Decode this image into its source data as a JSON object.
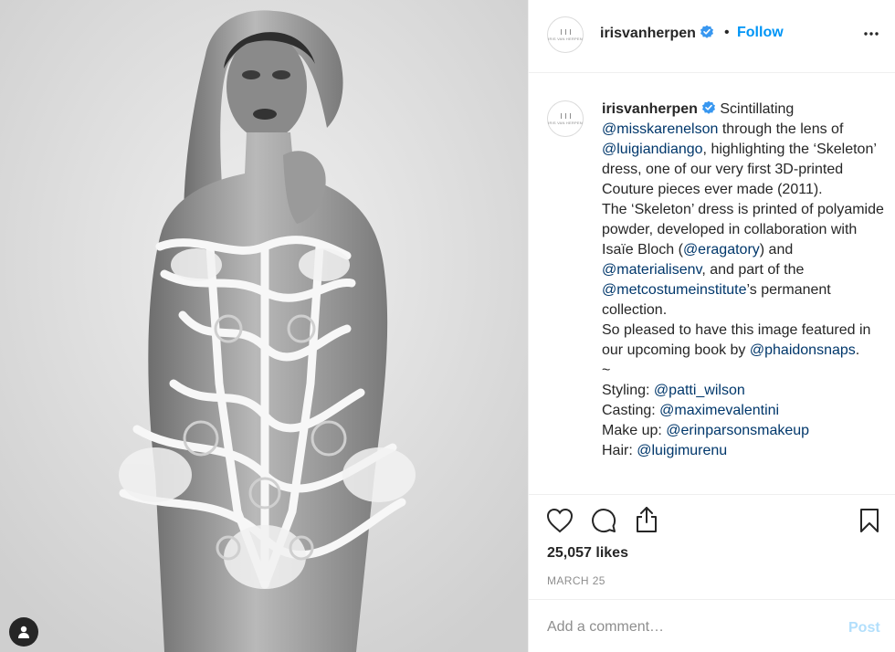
{
  "post": {
    "username": "irisvanherpen",
    "avatar_logo_text": "IRIS VAN HERPEN",
    "separator": "•",
    "follow_label": "Follow"
  },
  "caption": {
    "username": "irisvanherpen",
    "segments": [
      {
        "text": " Scintillating ",
        "mention": false
      },
      {
        "text": "@misskarenelson",
        "mention": true
      },
      {
        "text": " through the lens of ",
        "mention": false
      },
      {
        "text": "@luigiandiango",
        "mention": true
      },
      {
        "text": ", highlighting the ‘Skeleton’ dress, one of our very first 3D-printed Couture pieces ever made (2011).\nThe ‘Skeleton’ dress is printed of polyamide powder, developed in collaboration with Isaïe Bloch (",
        "mention": false
      },
      {
        "text": "@eragatory",
        "mention": true
      },
      {
        "text": ") and ",
        "mention": false
      },
      {
        "text": "@materialisenv",
        "mention": true
      },
      {
        "text": ", and part of the ",
        "mention": false
      },
      {
        "text": "@metcostumeinstitute",
        "mention": true
      },
      {
        "text": "’s permanent collection.\nSo pleased to have this image featured in our upcoming book by ",
        "mention": false
      },
      {
        "text": "@phaidonsnaps",
        "mention": true
      },
      {
        "text": ".\n~\nStyling: ",
        "mention": false
      },
      {
        "text": "@patti_wilson",
        "mention": true
      },
      {
        "text": "\nCasting: ",
        "mention": false
      },
      {
        "text": "@maximevalentini",
        "mention": true
      },
      {
        "text": "\nMake up: ",
        "mention": false
      },
      {
        "text": "@erinparsonsmakeup",
        "mention": true
      },
      {
        "text": "\nHair: ",
        "mention": false
      },
      {
        "text": "@luigimurenu",
        "mention": true
      }
    ]
  },
  "stats": {
    "likes": "25,057 likes",
    "date": "MARCH 25"
  },
  "comment": {
    "placeholder": "Add a comment…",
    "post_label": "Post"
  },
  "colors": {
    "accent": "#0095f6",
    "mention": "#00376b",
    "post_disabled": "#b2dffc",
    "verified": "#3897f0"
  },
  "icons": {
    "verified": "verified-badge-icon",
    "more": "more-options-icon",
    "like": "heart-icon",
    "comment": "comment-icon",
    "share": "share-icon",
    "save": "bookmark-icon",
    "user_tag": "user-tag-icon"
  }
}
